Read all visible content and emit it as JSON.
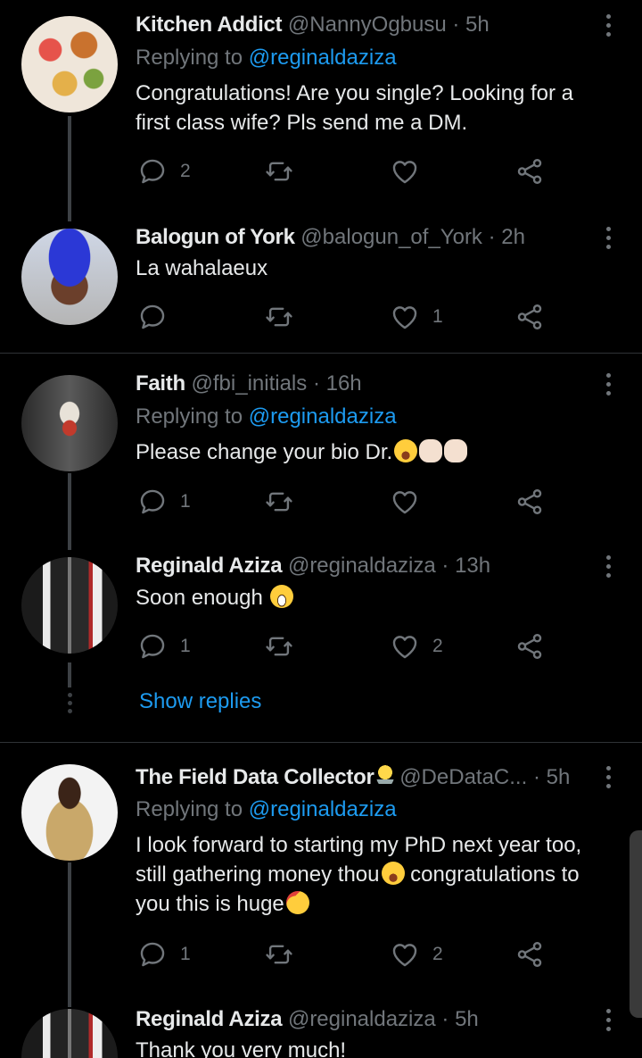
{
  "tweets": [
    {
      "name": "Kitchen Addict",
      "handle": "@NannyOgbusu",
      "time": "· 5h",
      "replying_prefix": "Replying to ",
      "replying_to": "@reginaldaziza",
      "text": "Congratulations! Are you single? Looking for a first class wife? Pls send me a DM.",
      "replies": "2",
      "retweets": "",
      "likes": ""
    },
    {
      "name": "Balogun of York",
      "handle": "@balogun_of_York",
      "time": "· 2h",
      "text": "La wahalaeux",
      "replies": "",
      "retweets": "",
      "likes": "1"
    },
    {
      "name": "Faith",
      "handle": "@fbi_initials",
      "time": "· 16h",
      "replying_prefix": "Replying to ",
      "replying_to": "@reginaldaziza",
      "text": "Please change your bio Dr.",
      "replies": "1",
      "retweets": "",
      "likes": ""
    },
    {
      "name": "Reginald Aziza",
      "handle": "@reginaldaziza",
      "time": "· 13h",
      "text": "Soon enough",
      "replies": "1",
      "retweets": "",
      "likes": "2"
    },
    {
      "name": "The Field Data Collector",
      "handle": "@DeDataC...",
      "time": "· 5h",
      "replying_prefix": "Replying to ",
      "replying_to": "@reginaldaziza",
      "text_line1": "I look forward to starting my PhD next year too,",
      "text_line2a": "still gathering money thou",
      "text_line2b": " congratulations to",
      "text_line3": "you this is huge",
      "replies": "1",
      "retweets": "",
      "likes": "2"
    },
    {
      "name": "Reginald Aziza",
      "handle": "@reginaldaziza",
      "time": "· 5h",
      "text": "Thank you very much!"
    }
  ],
  "show_replies_label": "Show replies",
  "icons": [
    "reply-icon",
    "retweet-icon",
    "like-icon",
    "share-icon",
    "more-icon"
  ],
  "colors": {
    "background": "#000000",
    "link": "#1d9bf0",
    "muted": "#71767b"
  }
}
